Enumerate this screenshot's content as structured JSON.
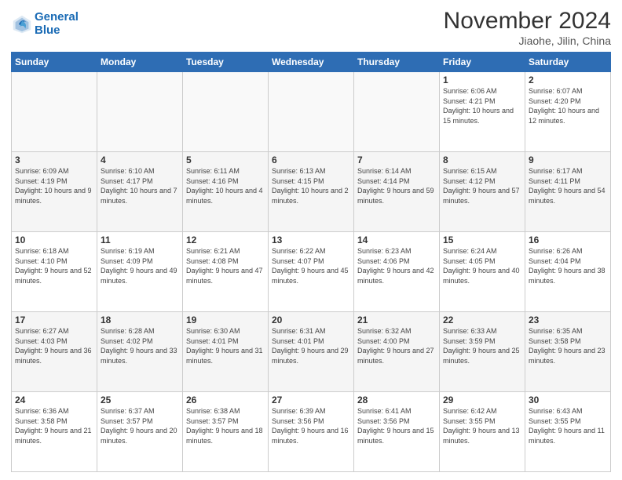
{
  "logo": {
    "line1": "General",
    "line2": "Blue"
  },
  "title": "November 2024",
  "subtitle": "Jiaohe, Jilin, China",
  "weekdays": [
    "Sunday",
    "Monday",
    "Tuesday",
    "Wednesday",
    "Thursday",
    "Friday",
    "Saturday"
  ],
  "weeks": [
    [
      {
        "day": "",
        "info": ""
      },
      {
        "day": "",
        "info": ""
      },
      {
        "day": "",
        "info": ""
      },
      {
        "day": "",
        "info": ""
      },
      {
        "day": "",
        "info": ""
      },
      {
        "day": "1",
        "info": "Sunrise: 6:06 AM\nSunset: 4:21 PM\nDaylight: 10 hours and 15 minutes."
      },
      {
        "day": "2",
        "info": "Sunrise: 6:07 AM\nSunset: 4:20 PM\nDaylight: 10 hours and 12 minutes."
      }
    ],
    [
      {
        "day": "3",
        "info": "Sunrise: 6:09 AM\nSunset: 4:19 PM\nDaylight: 10 hours and 9 minutes."
      },
      {
        "day": "4",
        "info": "Sunrise: 6:10 AM\nSunset: 4:17 PM\nDaylight: 10 hours and 7 minutes."
      },
      {
        "day": "5",
        "info": "Sunrise: 6:11 AM\nSunset: 4:16 PM\nDaylight: 10 hours and 4 minutes."
      },
      {
        "day": "6",
        "info": "Sunrise: 6:13 AM\nSunset: 4:15 PM\nDaylight: 10 hours and 2 minutes."
      },
      {
        "day": "7",
        "info": "Sunrise: 6:14 AM\nSunset: 4:14 PM\nDaylight: 9 hours and 59 minutes."
      },
      {
        "day": "8",
        "info": "Sunrise: 6:15 AM\nSunset: 4:12 PM\nDaylight: 9 hours and 57 minutes."
      },
      {
        "day": "9",
        "info": "Sunrise: 6:17 AM\nSunset: 4:11 PM\nDaylight: 9 hours and 54 minutes."
      }
    ],
    [
      {
        "day": "10",
        "info": "Sunrise: 6:18 AM\nSunset: 4:10 PM\nDaylight: 9 hours and 52 minutes."
      },
      {
        "day": "11",
        "info": "Sunrise: 6:19 AM\nSunset: 4:09 PM\nDaylight: 9 hours and 49 minutes."
      },
      {
        "day": "12",
        "info": "Sunrise: 6:21 AM\nSunset: 4:08 PM\nDaylight: 9 hours and 47 minutes."
      },
      {
        "day": "13",
        "info": "Sunrise: 6:22 AM\nSunset: 4:07 PM\nDaylight: 9 hours and 45 minutes."
      },
      {
        "day": "14",
        "info": "Sunrise: 6:23 AM\nSunset: 4:06 PM\nDaylight: 9 hours and 42 minutes."
      },
      {
        "day": "15",
        "info": "Sunrise: 6:24 AM\nSunset: 4:05 PM\nDaylight: 9 hours and 40 minutes."
      },
      {
        "day": "16",
        "info": "Sunrise: 6:26 AM\nSunset: 4:04 PM\nDaylight: 9 hours and 38 minutes."
      }
    ],
    [
      {
        "day": "17",
        "info": "Sunrise: 6:27 AM\nSunset: 4:03 PM\nDaylight: 9 hours and 36 minutes."
      },
      {
        "day": "18",
        "info": "Sunrise: 6:28 AM\nSunset: 4:02 PM\nDaylight: 9 hours and 33 minutes."
      },
      {
        "day": "19",
        "info": "Sunrise: 6:30 AM\nSunset: 4:01 PM\nDaylight: 9 hours and 31 minutes."
      },
      {
        "day": "20",
        "info": "Sunrise: 6:31 AM\nSunset: 4:01 PM\nDaylight: 9 hours and 29 minutes."
      },
      {
        "day": "21",
        "info": "Sunrise: 6:32 AM\nSunset: 4:00 PM\nDaylight: 9 hours and 27 minutes."
      },
      {
        "day": "22",
        "info": "Sunrise: 6:33 AM\nSunset: 3:59 PM\nDaylight: 9 hours and 25 minutes."
      },
      {
        "day": "23",
        "info": "Sunrise: 6:35 AM\nSunset: 3:58 PM\nDaylight: 9 hours and 23 minutes."
      }
    ],
    [
      {
        "day": "24",
        "info": "Sunrise: 6:36 AM\nSunset: 3:58 PM\nDaylight: 9 hours and 21 minutes."
      },
      {
        "day": "25",
        "info": "Sunrise: 6:37 AM\nSunset: 3:57 PM\nDaylight: 9 hours and 20 minutes."
      },
      {
        "day": "26",
        "info": "Sunrise: 6:38 AM\nSunset: 3:57 PM\nDaylight: 9 hours and 18 minutes."
      },
      {
        "day": "27",
        "info": "Sunrise: 6:39 AM\nSunset: 3:56 PM\nDaylight: 9 hours and 16 minutes."
      },
      {
        "day": "28",
        "info": "Sunrise: 6:41 AM\nSunset: 3:56 PM\nDaylight: 9 hours and 15 minutes."
      },
      {
        "day": "29",
        "info": "Sunrise: 6:42 AM\nSunset: 3:55 PM\nDaylight: 9 hours and 13 minutes."
      },
      {
        "day": "30",
        "info": "Sunrise: 6:43 AM\nSunset: 3:55 PM\nDaylight: 9 hours and 11 minutes."
      }
    ]
  ]
}
